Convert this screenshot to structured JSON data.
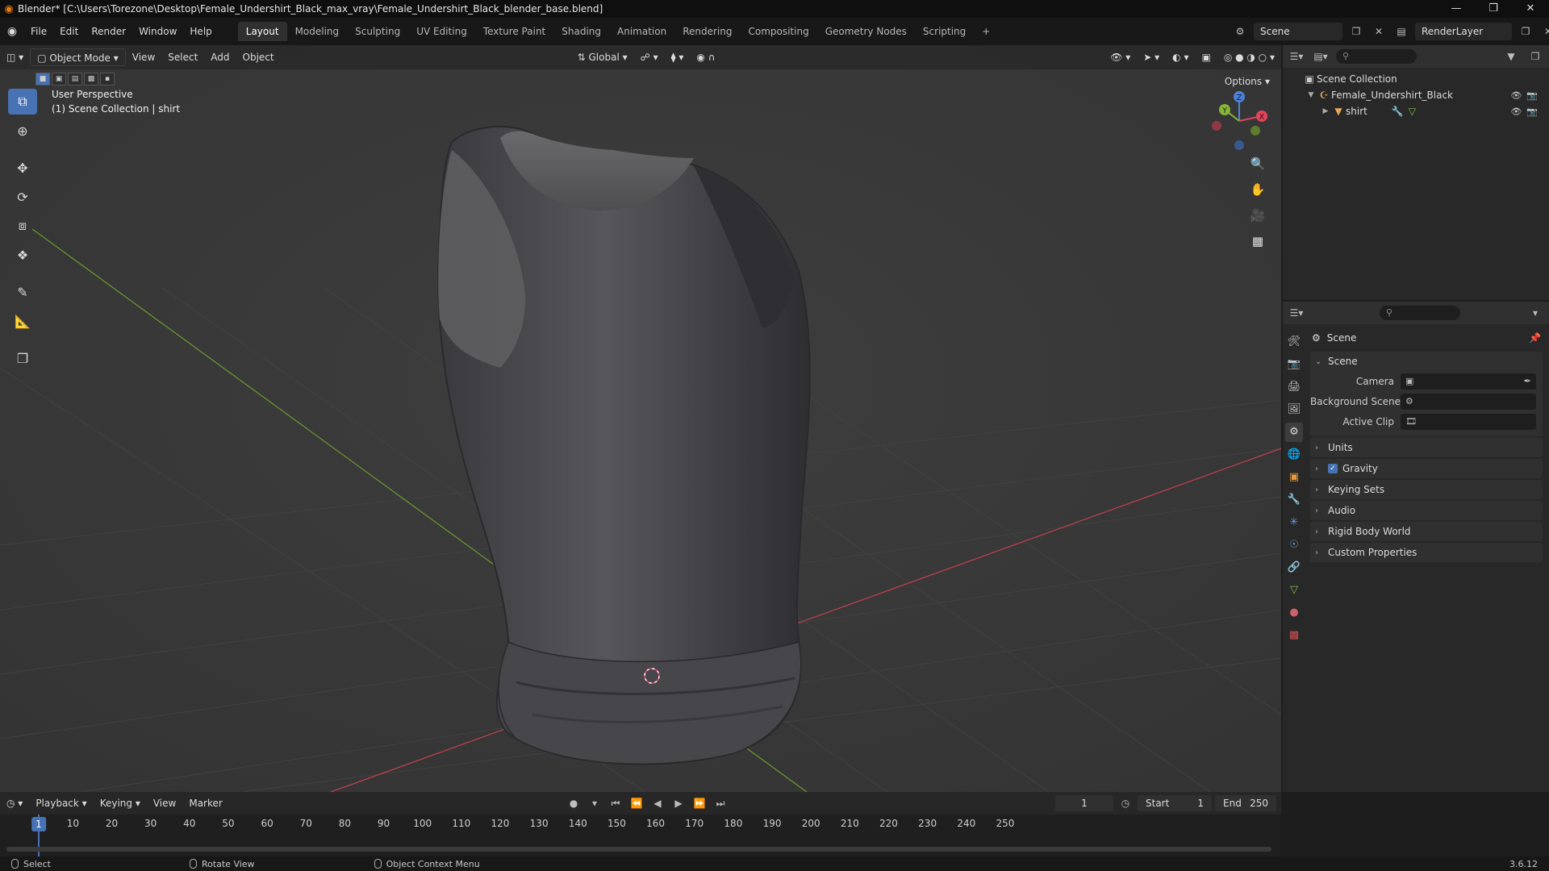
{
  "app": {
    "title": "Blender* [C:\\Users\\Torezone\\Desktop\\Female_Undershirt_Black_max_vray\\Female_Undershirt_Black_blender_base.blend]",
    "version": "3.6.12"
  },
  "menu": {
    "items": [
      "File",
      "Edit",
      "Render",
      "Window",
      "Help"
    ]
  },
  "workspaces": {
    "tabs": [
      "Layout",
      "Modeling",
      "Sculpting",
      "UV Editing",
      "Texture Paint",
      "Shading",
      "Animation",
      "Rendering",
      "Compositing",
      "Geometry Nodes",
      "Scripting"
    ],
    "active": "Layout",
    "add": "+"
  },
  "top_right": {
    "scene": "Scene",
    "view_layer": "RenderLayer"
  },
  "viewport": {
    "mode": "Object Mode",
    "menus": [
      "View",
      "Select",
      "Add",
      "Object"
    ],
    "transform_orientation": "Global",
    "options_label": "Options",
    "info_line1": "User Perspective",
    "info_line2": "(1) Scene Collection | shirt",
    "gizmo": {
      "x": "X",
      "y": "Y",
      "z": "Z"
    }
  },
  "outliner": {
    "root": "Scene Collection",
    "collection": "Female_Undershirt_Black",
    "object": "shirt"
  },
  "properties": {
    "context": "Scene",
    "panel_scene": "Scene",
    "camera_label": "Camera",
    "background_scene_label": "Background Scene",
    "active_clip_label": "Active Clip",
    "panels": [
      "Units",
      "Gravity",
      "Keying Sets",
      "Audio",
      "Rigid Body World",
      "Custom Properties"
    ]
  },
  "timeline": {
    "menus": [
      "Playback",
      "Keying",
      "View",
      "Marker"
    ],
    "current_frame": "1",
    "start_label": "Start",
    "start": "1",
    "end_label": "End",
    "end": "250",
    "ticks": [
      "10",
      "20",
      "30",
      "40",
      "50",
      "60",
      "70",
      "80",
      "90",
      "100",
      "110",
      "120",
      "130",
      "140",
      "150",
      "160",
      "170",
      "180",
      "190",
      "200",
      "210",
      "220",
      "230",
      "240",
      "250"
    ]
  },
  "status": {
    "left": "Select",
    "middle": "Rotate View",
    "right": "Object Context Menu"
  },
  "colors": {
    "accent": "#4772b3",
    "x_axis": "#e2455c",
    "y_axis": "#86b53a",
    "z_axis": "#4b82d8",
    "shirt": "#4a4a4f"
  }
}
